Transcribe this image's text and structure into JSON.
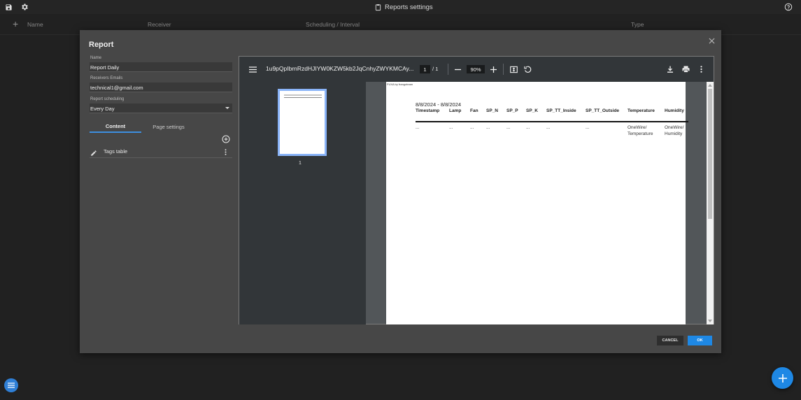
{
  "topbar": {
    "title": "Reports settings",
    "icons": [
      "save-icon",
      "gear-icon",
      "clipboard-icon",
      "help-icon"
    ]
  },
  "list_header": {
    "columns": [
      "Name",
      "Receiver",
      "Scheduling / Interval",
      "Type"
    ]
  },
  "dialog": {
    "title": "Report",
    "name_label": "Name",
    "name_value": "Report Daily",
    "receivers_label": "Receivers Emails",
    "receivers_value": "technical1@gmail.com",
    "scheduling_label": "Report scheduling",
    "scheduling_value": "Every Day",
    "tabs": [
      "Content",
      "Page settings"
    ],
    "active_tab": "Content",
    "items": [
      {
        "label": "Tags table"
      }
    ],
    "cancel_label": "CANCEL",
    "ok_label": "OK"
  },
  "pdf_viewer": {
    "filename": "1u9pQpIbrnRzdHJIYW0KZW5kb2JqCnhyZWYKMCAy...",
    "current_page": "1",
    "page_sep": "/",
    "total_pages": "1",
    "zoom": "90%",
    "thumbnail_label": "1"
  },
  "pdf_page": {
    "header_small": "FUXA by frangoteam",
    "date_range": "8/8/2024 - 8/8/2024",
    "columns": [
      "Timestamp",
      "Lamp",
      "Fan",
      "SP_N",
      "SP_P",
      "SP_K",
      "SP_TT_Inside",
      "SP_TT_Outside",
      "Temperature",
      "Humidity"
    ],
    "row": [
      "...",
      "...",
      "...",
      "...",
      "...",
      "...",
      "...",
      "...",
      "OneWire/\nTemperature",
      "OneWire/\nHumidity"
    ]
  },
  "colors": {
    "accent": "#1e88e5",
    "tab_indicator": "#3d8fe0",
    "dialog_bg": "#474747",
    "app_bg": "#2b2b2b"
  }
}
